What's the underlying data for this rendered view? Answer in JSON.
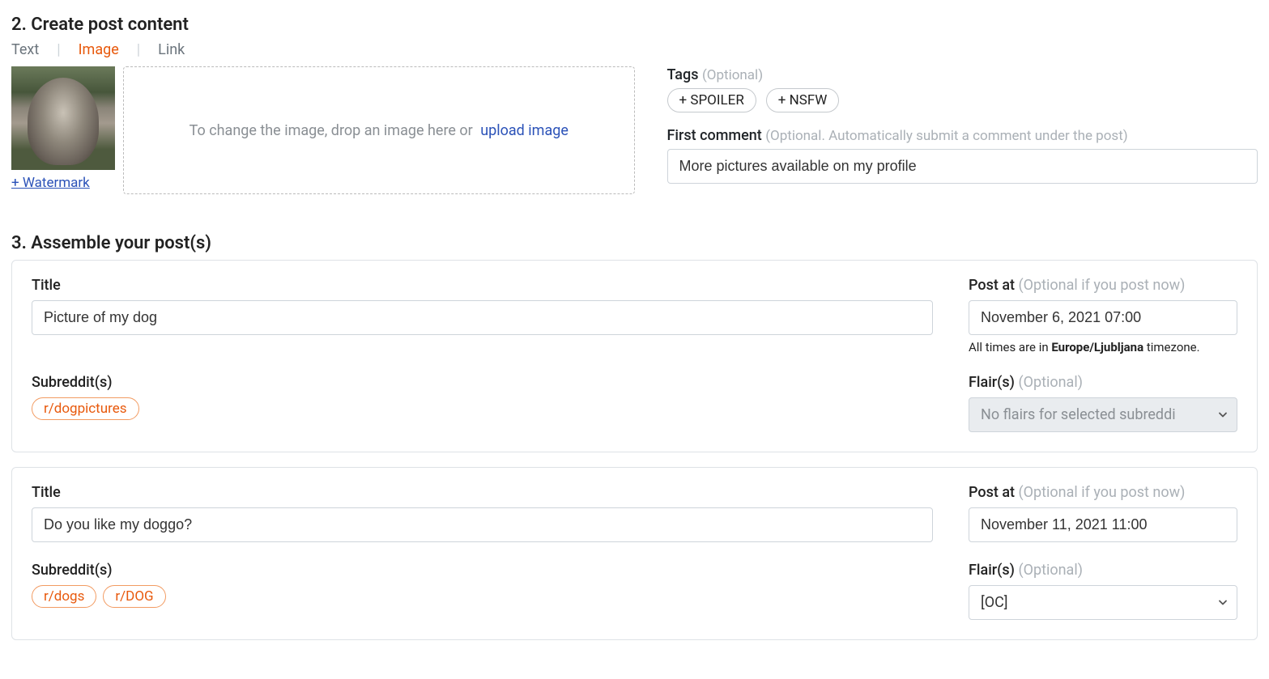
{
  "section2": {
    "title": "2. Create post content",
    "tabs": {
      "text": "Text",
      "image": "Image",
      "link": "Link",
      "active": "image"
    },
    "watermark_link": "+ Watermark",
    "dropzone_prefix": "To change the image, drop an image here or",
    "dropzone_upload": "upload image",
    "tags": {
      "label": "Tags",
      "optional": "(Optional)",
      "spoiler": "+ SPOILER",
      "nsfw": "+ NSFW"
    },
    "first_comment": {
      "label": "First comment",
      "optional": "(Optional. Automatically submit a comment under the post)",
      "value": "More pictures available on my profile"
    }
  },
  "section3": {
    "title": "3. Assemble your post(s)",
    "labels": {
      "title": "Title",
      "postat": "Post at",
      "postat_optional": "(Optional if you post now)",
      "subreddits": "Subreddit(s)",
      "flairs": "Flair(s)",
      "flairs_optional": "(Optional)",
      "tz_prefix": "All times are in ",
      "tz_value": "Europe/Ljubljana",
      "tz_suffix": " timezone."
    },
    "posts": [
      {
        "title": "Picture of my dog",
        "post_at": "November 6, 2021 07:00",
        "subreddits": [
          "r/dogpictures"
        ],
        "flair_select_disabled": true,
        "flair_placeholder": "No flairs for selected subreddi",
        "show_tz_note": true
      },
      {
        "title": "Do you like my doggo?",
        "post_at": "November 11, 2021 11:00",
        "subreddits": [
          "r/dogs",
          "r/DOG"
        ],
        "flair_select_disabled": false,
        "flair_value": "[OC]",
        "show_tz_note": false
      }
    ]
  }
}
